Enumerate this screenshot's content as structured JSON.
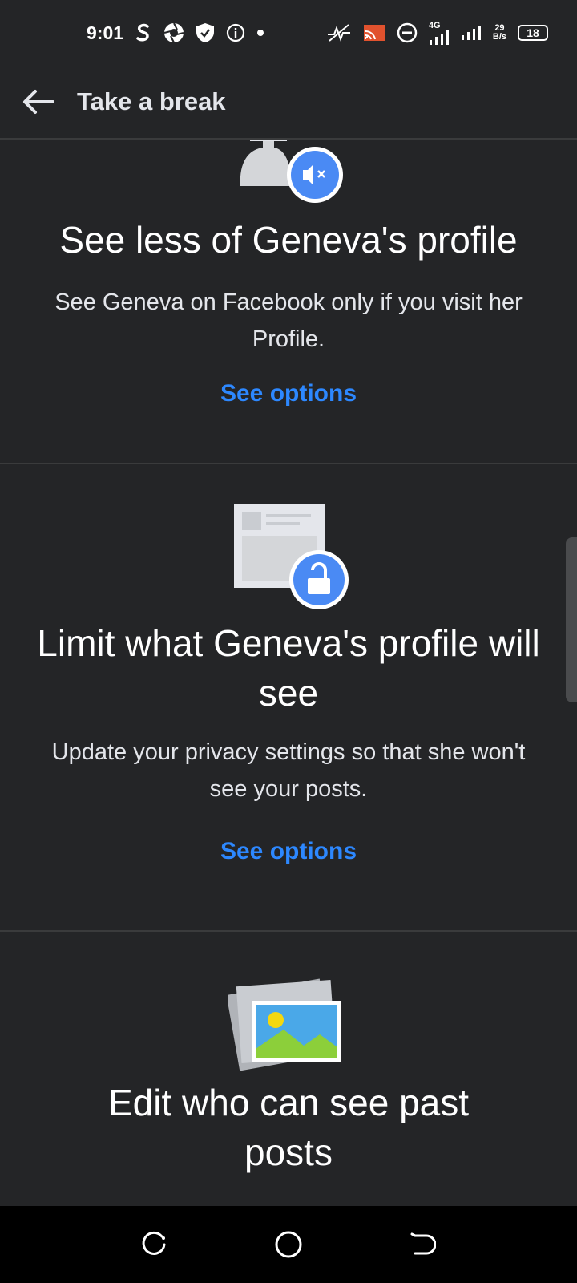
{
  "status_bar": {
    "time": "9:01",
    "network_label": "4G",
    "net_speed_value": "29",
    "net_speed_unit": "B/s",
    "battery": "18",
    "left_icons": [
      "s-app-icon",
      "shutter-icon",
      "shield-icon",
      "info-icon",
      "dot-icon"
    ],
    "right_icons": [
      "wifi-off-icon",
      "cast-icon",
      "dnd-icon",
      "signal-icon",
      "signal-icon-2",
      "battery-icon"
    ]
  },
  "app_bar": {
    "title": "Take a break"
  },
  "sections": [
    {
      "title": "See less of Geneva's profile",
      "description": "See Geneva on Facebook only if you visit her Profile.",
      "action": "See options",
      "icon": "mute-icon"
    },
    {
      "title": "Limit what Geneva's profile will see",
      "description": "Update your privacy settings so that she won't see your posts.",
      "action": "See options",
      "icon": "unlock-icon"
    },
    {
      "title": "Edit who can see past posts",
      "icon": "photo-icon"
    }
  ],
  "colors": {
    "background": "#242527",
    "accent": "#2d88ff",
    "divider": "#3a3b3c"
  }
}
